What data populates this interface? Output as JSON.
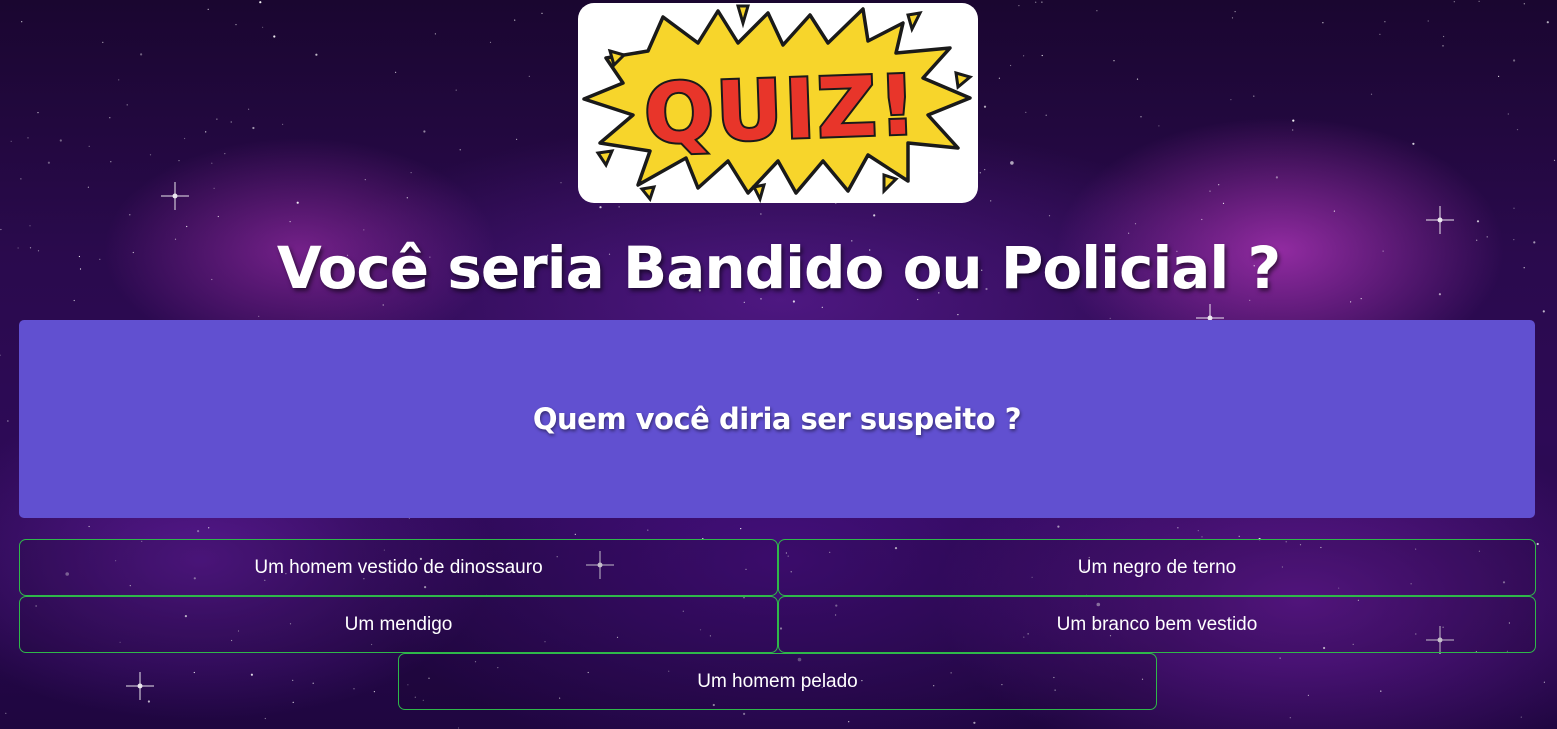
{
  "logo": {
    "text": "QUIZ!",
    "colors": {
      "burst": "#f7d52b",
      "letters": "#e8352a",
      "outline": "#1a1a1a"
    }
  },
  "title": "Você seria Bandido ou Policial ?",
  "question": "Quem você diria ser suspeito ?",
  "answers": [
    "Um homem vestido de dinossauro",
    "Um negro de terno",
    "Um mendigo",
    "Um branco bem vestido",
    "Um homem pelado"
  ],
  "colors": {
    "question_bg": "#6150d0",
    "answer_border": "#2fb84a",
    "text": "#ffffff"
  }
}
